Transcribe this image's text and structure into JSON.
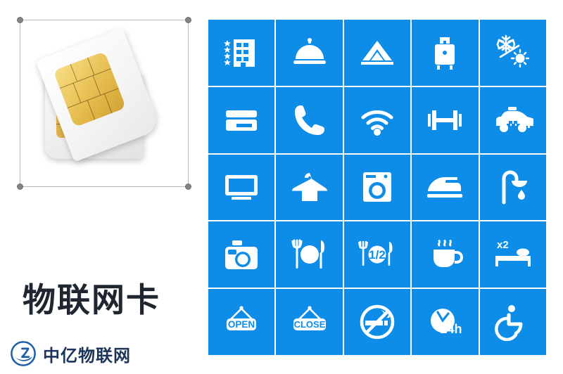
{
  "left_panel": {
    "heading": "物联网卡",
    "watermark_text": "中亿物联网",
    "watermark_logo_name": "zhongyi-circular-logo",
    "artwork_name": "sim-card-illustration",
    "selection_handles": [
      "top-left",
      "top-right",
      "bottom-left",
      "bottom-right"
    ]
  },
  "colors": {
    "tile_blue": "#0d8ce8",
    "icon_white": "#ffffff",
    "heading_dark": "#1f2630",
    "watermark_navy": "#1b3458",
    "frame_gray": "#b9b9b9",
    "handle_gray": "#838383",
    "sim_gold": "#ecc85f",
    "page_background": "#ffffff"
  },
  "icon_grid": {
    "rows": 5,
    "columns": 5,
    "tiles": [
      {
        "name": "hotel-stars-icon",
        "label": "Hotel (star rating)"
      },
      {
        "name": "room-service-bell-icon",
        "label": "Room service"
      },
      {
        "name": "tent-camping-icon",
        "label": "Camping / tent"
      },
      {
        "name": "luggage-icon",
        "label": "Luggage storage"
      },
      {
        "name": "air-conditioning-icon",
        "label": "Air conditioning"
      },
      {
        "name": "credit-card-icon",
        "label": "Card payment"
      },
      {
        "name": "telephone-icon",
        "label": "Telephone"
      },
      {
        "name": "wifi-icon",
        "label": "Wi-Fi"
      },
      {
        "name": "dumbbell-gym-icon",
        "label": "Gym / fitness"
      },
      {
        "name": "taxi-icon",
        "label": "Taxi"
      },
      {
        "name": "television-icon",
        "label": "Television"
      },
      {
        "name": "clothes-hanger-icon",
        "label": "Wardrobe / hanger"
      },
      {
        "name": "washing-machine-icon",
        "label": "Laundry"
      },
      {
        "name": "iron-icon",
        "label": "Ironing"
      },
      {
        "name": "shower-icon",
        "label": "Shower"
      },
      {
        "name": "camera-icon",
        "label": "Photography"
      },
      {
        "name": "restaurant-icon",
        "label": "Restaurant"
      },
      {
        "name": "half-board-icon",
        "label": "Half board",
        "text": "1/2"
      },
      {
        "name": "coffee-cup-icon",
        "label": "Coffee / breakfast"
      },
      {
        "name": "double-bed-icon",
        "label": "Double bed",
        "text": "x2"
      },
      {
        "name": "open-sign-icon",
        "label": "Open",
        "text": "OPEN"
      },
      {
        "name": "close-sign-icon",
        "label": "Closed",
        "text": "CLOSE"
      },
      {
        "name": "no-smoking-icon",
        "label": "No smoking"
      },
      {
        "name": "24-hour-clock-icon",
        "label": "24 hour service",
        "text": "24h"
      },
      {
        "name": "wheelchair-access-icon",
        "label": "Wheelchair accessible"
      }
    ]
  }
}
